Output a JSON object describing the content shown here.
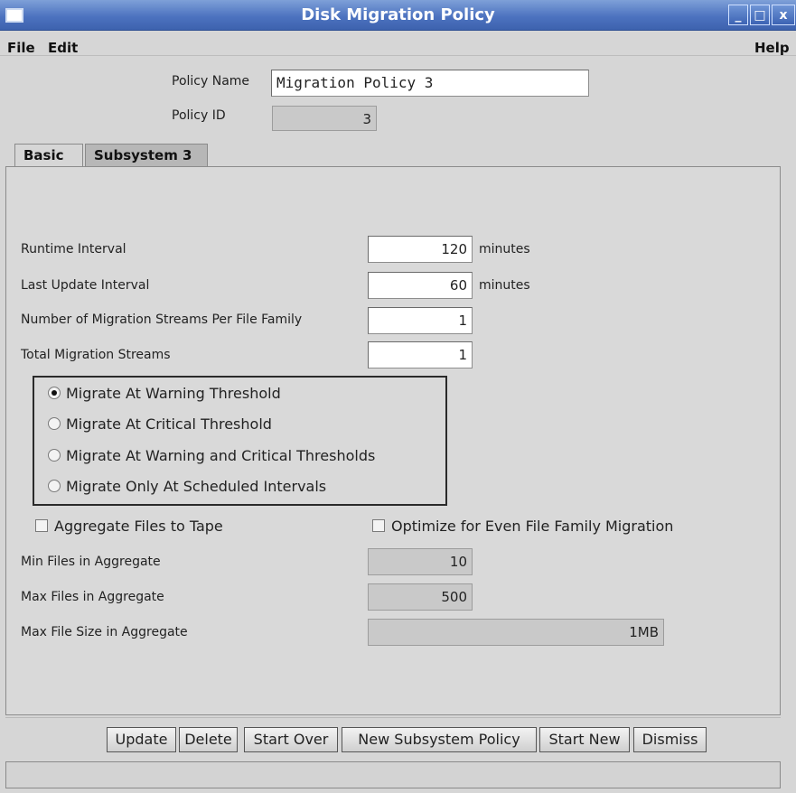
{
  "window": {
    "title": "Disk Migration Policy",
    "controls": {
      "minimize": "_",
      "maximize": "□",
      "close": "x"
    }
  },
  "menubar": {
    "file": "File",
    "edit": "Edit",
    "help": "Help"
  },
  "header": {
    "policy_name_label": "Policy Name",
    "policy_name_value": "Migration Policy 3",
    "policy_id_label": "Policy ID",
    "policy_id_value": "3"
  },
  "tabs": [
    {
      "label": "Basic",
      "active": true
    },
    {
      "label": "Subsystem 3",
      "active": false
    }
  ],
  "basic": {
    "runtime_interval_label": "Runtime Interval",
    "runtime_interval_value": "120",
    "runtime_interval_unit": "minutes",
    "last_update_label": "Last Update Interval",
    "last_update_value": "60",
    "last_update_unit": "minutes",
    "streams_per_family_label": "Number of Migration Streams Per File Family",
    "streams_per_family_value": "1",
    "total_streams_label": "Total Migration Streams",
    "total_streams_value": "1",
    "radios": [
      {
        "label": "Migrate At Warning Threshold",
        "selected": true
      },
      {
        "label": "Migrate At Critical Threshold",
        "selected": false
      },
      {
        "label": "Migrate At Warning and Critical Thresholds",
        "selected": false
      },
      {
        "label": "Migrate Only At Scheduled Intervals",
        "selected": false
      }
    ],
    "aggregate_label": "Aggregate Files to Tape",
    "aggregate_checked": false,
    "optimize_label": "Optimize for Even File Family Migration",
    "optimize_checked": false,
    "min_files_label": "Min Files in Aggregate",
    "min_files_value": "10",
    "max_files_label": "Max Files in Aggregate",
    "max_files_value": "500",
    "max_size_label": "Max File Size in Aggregate",
    "max_size_value": "1MB"
  },
  "buttons": {
    "update": "Update",
    "delete": "Delete",
    "start_over": "Start Over",
    "new_subsystem": "New Subsystem Policy",
    "start_new": "Start New",
    "dismiss": "Dismiss"
  },
  "status_text": ""
}
